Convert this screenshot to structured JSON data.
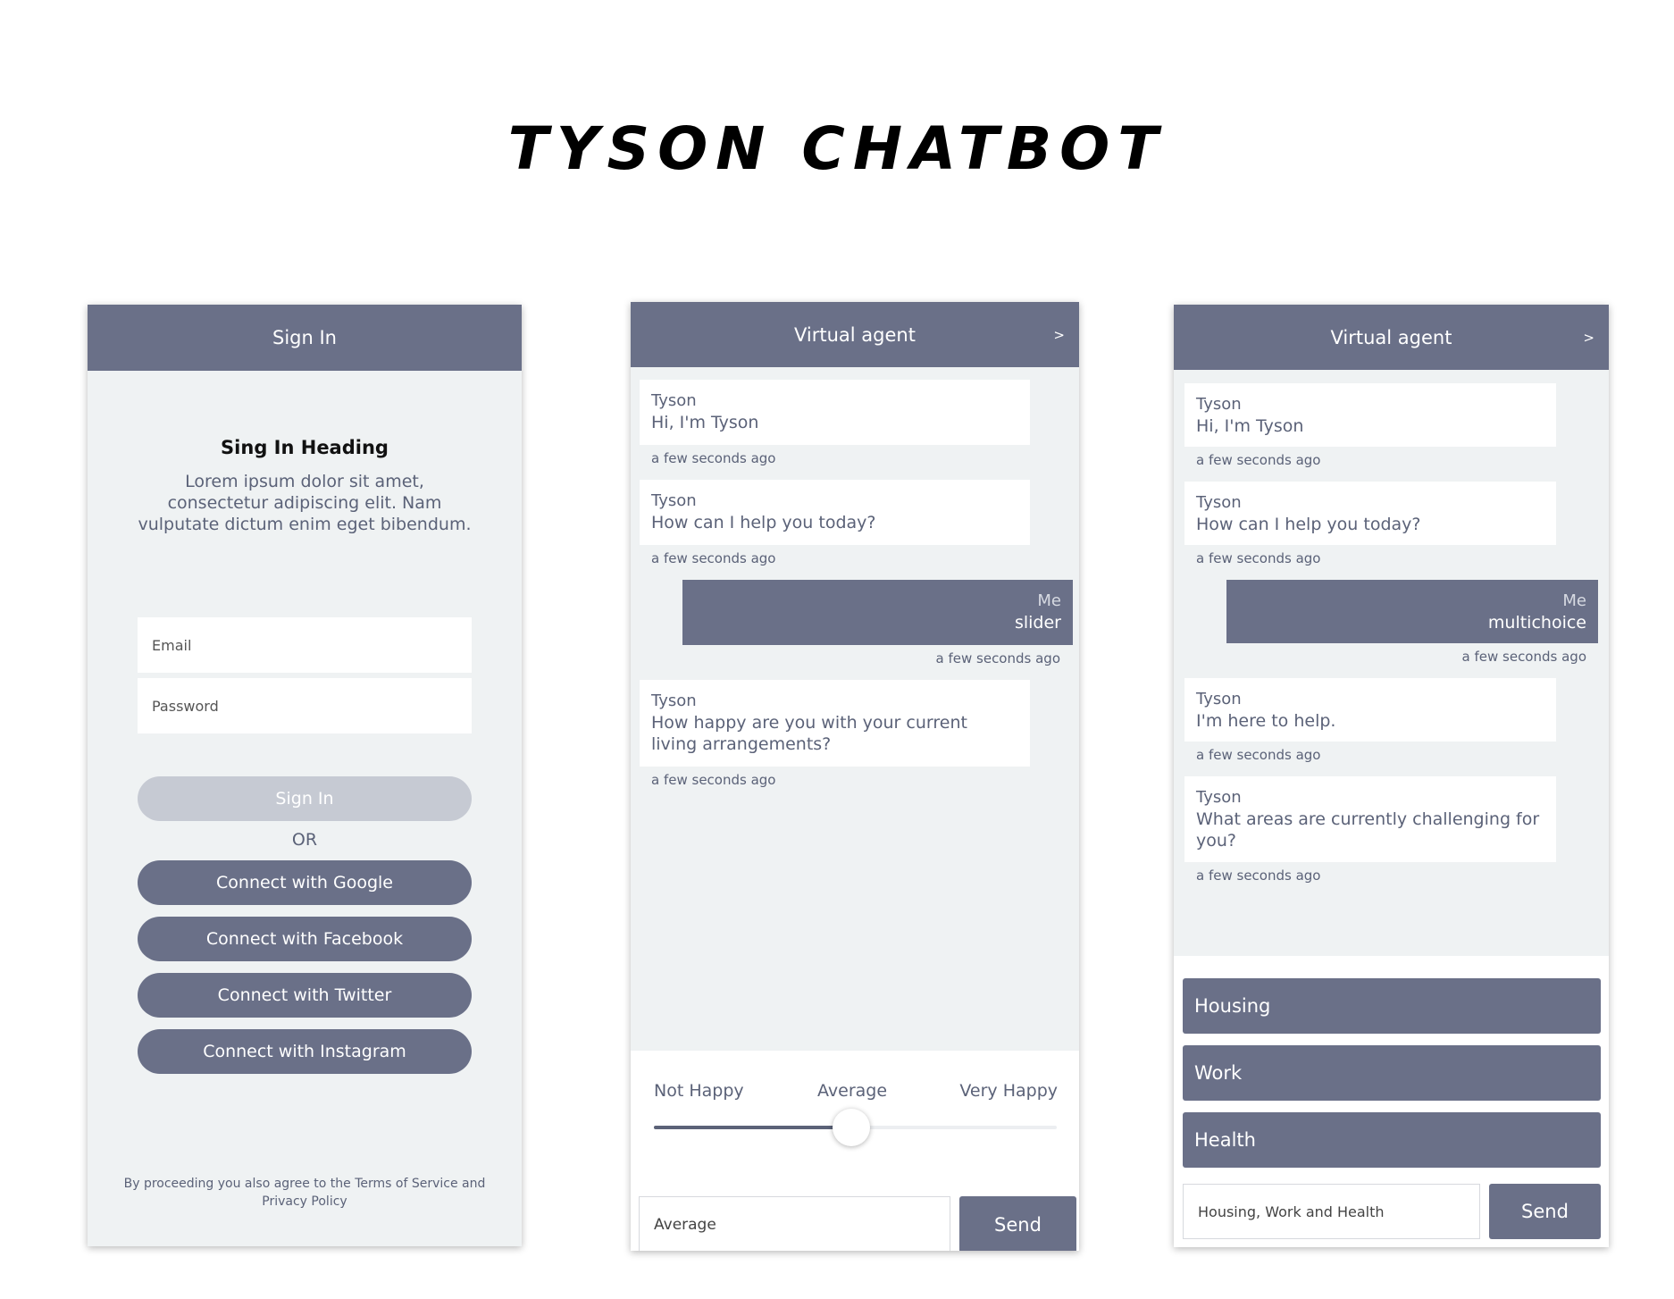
{
  "page": {
    "title": "TYSON CHATBOT"
  },
  "signin": {
    "header": "Sign In",
    "heading": "Sing In Heading",
    "description": "Lorem ipsum dolor sit amet, consectetur adipiscing elit. Nam vulputate dictum enim eget bibendum.",
    "email_placeholder": "Email",
    "password_placeholder": "Password",
    "signin_button": "Sign In",
    "or_text": "OR",
    "social_buttons": [
      "Connect with Google",
      "Connect with Facebook",
      "Connect with Twitter",
      "Connect with Instagram"
    ],
    "legal": "By proceeding you also agree to the Terms of Service and Privacy Policy"
  },
  "chat_slider": {
    "header": "Virtual agent",
    "header_arrow": ">",
    "messages": [
      {
        "sender": "Tyson",
        "text": "Hi, I'm Tyson",
        "time": "a few seconds ago"
      },
      {
        "sender": "Tyson",
        "text": "How can I help you today?",
        "time": "a few seconds ago"
      },
      {
        "sender": "Me",
        "text": "slider",
        "time": "a few seconds ago"
      },
      {
        "sender": "Tyson",
        "text": "How happy are you with your current living arrangements?",
        "time": "a few seconds ago"
      }
    ],
    "slider": {
      "labels": [
        "Not Happy",
        "Average",
        "Very Happy"
      ],
      "value": 0.49
    },
    "input_value": "Average",
    "send_label": "Send"
  },
  "chat_multi": {
    "header": "Virtual agent",
    "header_arrow": ">",
    "messages": [
      {
        "sender": "Tyson",
        "text": "Hi, I'm Tyson",
        "time": "a few seconds ago"
      },
      {
        "sender": "Tyson",
        "text": "How can I help you today?",
        "time": "a few seconds ago"
      },
      {
        "sender": "Me",
        "text": "multichoice",
        "time": "a few seconds ago"
      },
      {
        "sender": "Tyson",
        "text": "I'm here to help.",
        "time": "a few seconds ago"
      },
      {
        "sender": "Tyson",
        "text": "What areas are currently challenging for you?",
        "time": "a few seconds ago"
      }
    ],
    "choices": [
      "Housing",
      "Work",
      "Health"
    ],
    "input_value": "Housing, Work and Health",
    "send_label": "Send"
  },
  "colors": {
    "accent": "#6a7088",
    "panel_bg": "#eff2f3",
    "disabled": "#c6cad3",
    "text": "#5b6278"
  }
}
